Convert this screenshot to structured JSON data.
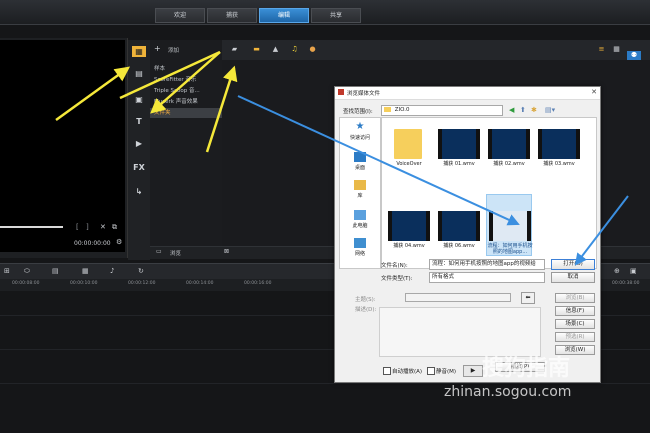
{
  "tabs": [
    {
      "label": "欢迎"
    },
    {
      "label": "捕获"
    },
    {
      "label": "编辑"
    },
    {
      "label": "共享"
    }
  ],
  "active_tab": "编辑",
  "preview": {
    "timecode": "00:00:00:00",
    "progress_fraction": 0.5
  },
  "library": {
    "add_label": "添加",
    "items": [
      "样本",
      "ScoreFitter 音乐",
      "Triple Scoop 音...",
      "Muzerk 声音效果",
      "文件夹"
    ],
    "selected": "文件夹",
    "browse_label": "浏览"
  },
  "timeline": {
    "ruler": [
      "00:00:08:00",
      "00:00:10:00",
      "00:00:12:00",
      "00:00:14:00",
      "00:00:16:00",
      "00:00:36:00",
      "00:00:38:00"
    ]
  },
  "dialog": {
    "title": "浏览媒体文件",
    "lookin_label": "查找范围(I):",
    "lookin_value": "ZIO.0",
    "places": [
      "快速访问",
      "桌面",
      "库",
      "此电脑",
      "网络"
    ],
    "files": [
      {
        "caption": "VoiceOver",
        "kind": "folder"
      },
      {
        "caption": "捕获 01.wmv",
        "kind": "video"
      },
      {
        "caption": "捕获 02.wmv",
        "kind": "video"
      },
      {
        "caption": "捕获 03.wmv",
        "kind": "video"
      },
      {
        "caption": "捕获 04.wmv",
        "kind": "video"
      },
      {
        "caption": "捕获 06.wmv",
        "kind": "video"
      },
      {
        "caption": "流程：如何用手机按照的地图app...",
        "kind": "screen"
      }
    ],
    "selected_file": "流程：如何用手机按照的地图app...",
    "filename_label": "文件名(N):",
    "filename_value": "流程：如何用手机按照的地图app的视频给",
    "filetype_label": "文件类型(T):",
    "filetype_value": "所有格式",
    "open_label": "打开(O)",
    "cancel_label": "取消",
    "subject_label": "主题(S):",
    "description_label": "描述(D):",
    "side_buttons": [
      "浏览(B)",
      "信息(F)",
      "场景(C)",
      "预选(R)",
      "浏览(W)"
    ],
    "autoplay_label": "自动播放(A)",
    "mute_label": "静音(M)",
    "play_label": "播放(P)"
  },
  "watermark": {
    "logo": "搜狗指南",
    "url": "zhinan.sogou.com"
  },
  "colors": {
    "accent_tab": "#2b7bc6",
    "arrow_yellow": "#f5e83a",
    "arrow_blue": "#3b8fe0",
    "selected_tree_text": "#ffb23f"
  }
}
